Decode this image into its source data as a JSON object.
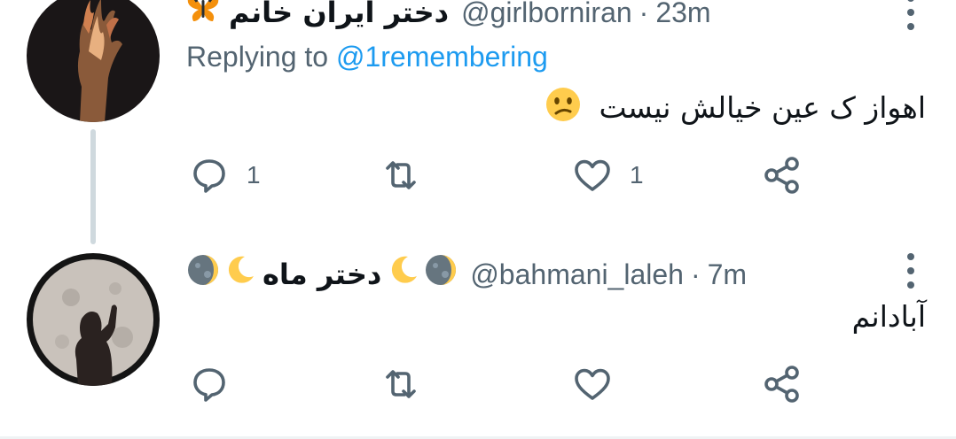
{
  "tweets": [
    {
      "display_name": "دختر ایران خانم",
      "name_emoji": "butterfly-emoji",
      "handle": "@girlborniran",
      "separator": "·",
      "time": "23m",
      "replying_prefix": "Replying to",
      "replying_to": "@1remembering",
      "text": "اهواز ک عین خیالش نیست",
      "text_emoji": "confused-face-emoji",
      "actions": {
        "reply_count": "1",
        "retweet_count": "",
        "like_count": "1"
      }
    },
    {
      "display_name": "دختر ماه",
      "name_emojis": [
        "new-moon-emoji",
        "crescent-moon-emoji"
      ],
      "handle": "@bahmani_laleh",
      "separator": "·",
      "time": "7m",
      "text": "آبادانم",
      "actions": {
        "reply_count": "",
        "retweet_count": "",
        "like_count": ""
      }
    }
  ],
  "colors": {
    "text_primary": "#0f1419",
    "text_secondary": "#536471",
    "link": "#1d9bf0",
    "thread_line": "#cfd9de"
  }
}
